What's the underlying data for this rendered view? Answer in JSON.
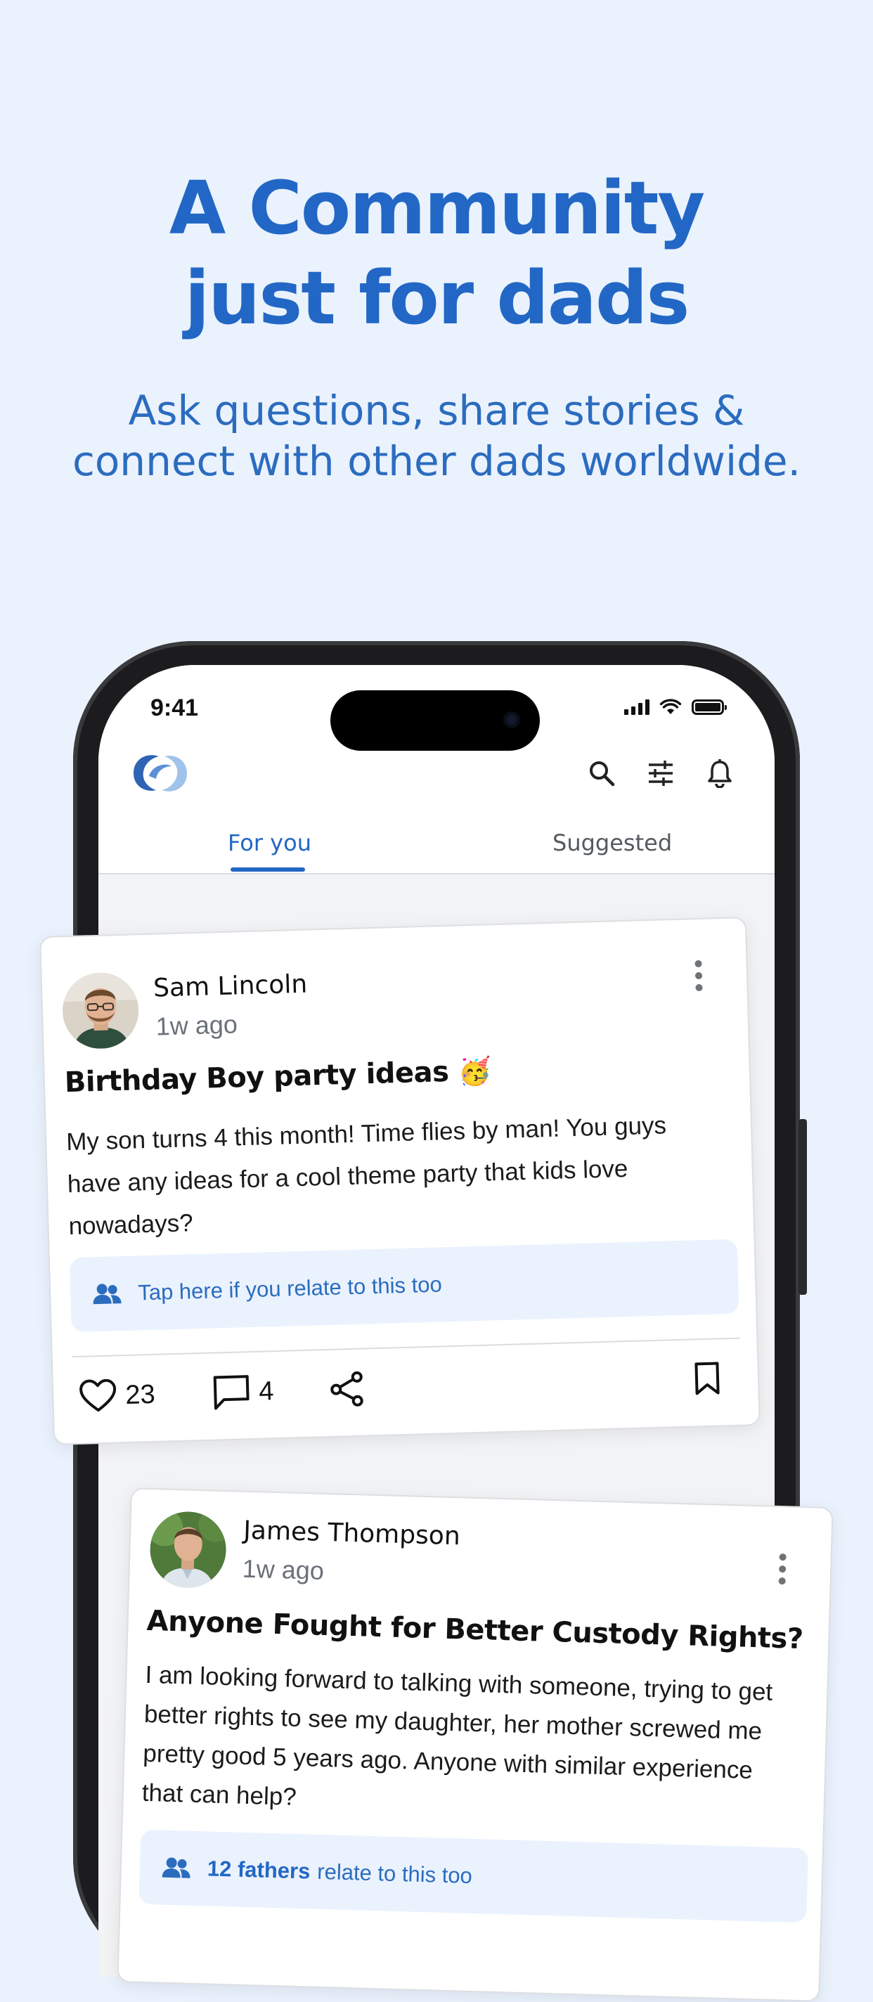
{
  "hero": {
    "title_line1": "A Community",
    "title_line2": "just for dads",
    "subtitle_line1": "Ask questions, share stories &",
    "subtitle_line2": "connect with other dads worldwide."
  },
  "status_bar": {
    "time": "9:41"
  },
  "app_header": {
    "icons": [
      "app-logo",
      "search-icon",
      "filter-sliders-icon",
      "bell-icon"
    ]
  },
  "tabs": [
    {
      "label": "For you",
      "active": true
    },
    {
      "label": "Suggested",
      "active": false
    }
  ],
  "posts": [
    {
      "author": "Sam Lincoln",
      "time": "1w ago",
      "title": "Birthday Boy party ideas",
      "emoji": "🥳",
      "body_line1": "My son turns 4 this month! Time flies by man! You guys",
      "body_line2": "have any ideas for a cool theme party that kids love",
      "body_line3": "nowadays?",
      "relate_text": "Tap here if you relate to this too",
      "likes": "23",
      "comments": "4"
    },
    {
      "author": "James Thompson",
      "time": "1w ago",
      "title": "Anyone Fought for Better Custody Rights?",
      "body_line1": "I am looking forward to talking with someone, trying to get",
      "body_line2": "better rights to see my daughter, her mother screwed me",
      "body_line3": "pretty good 5 years ago. Anyone with similar experience",
      "body_line4": "that can help?",
      "relate_count": "12 fathers",
      "relate_text": "relate to this too"
    }
  ],
  "colors": {
    "accent": "#2267c5",
    "background": "#eaf2fd",
    "card": "#ffffff"
  }
}
